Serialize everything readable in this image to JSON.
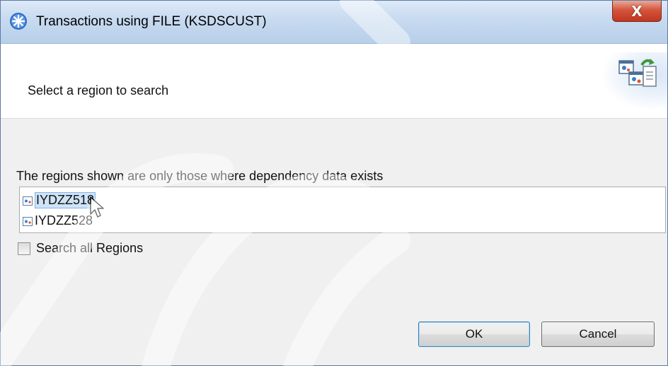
{
  "window": {
    "title": "Transactions using FILE (KSDSCUST)",
    "close_label": "X"
  },
  "header": {
    "description": "Select a region to search"
  },
  "main": {
    "info_label": "The regions shown are only those where dependency data exists",
    "regions": [
      {
        "label": "IYDZZ518",
        "selected": true
      },
      {
        "label": "IYDZZ528",
        "selected": false
      }
    ],
    "search_all": {
      "label": "Search all Regions",
      "checked": false
    }
  },
  "buttons": {
    "ok_label": "OK",
    "cancel_label": "Cancel"
  },
  "icons": {
    "app": "asterisk-app-icon",
    "header": "region-wizard-icon",
    "region_item": "region-icon",
    "cursor": "mouse-pointer-icon"
  },
  "colors": {
    "titlebar": "#c7daf0",
    "close_button": "#c1361f",
    "selection": "#cfe3f6",
    "default_button_border": "#3c7fb1"
  }
}
